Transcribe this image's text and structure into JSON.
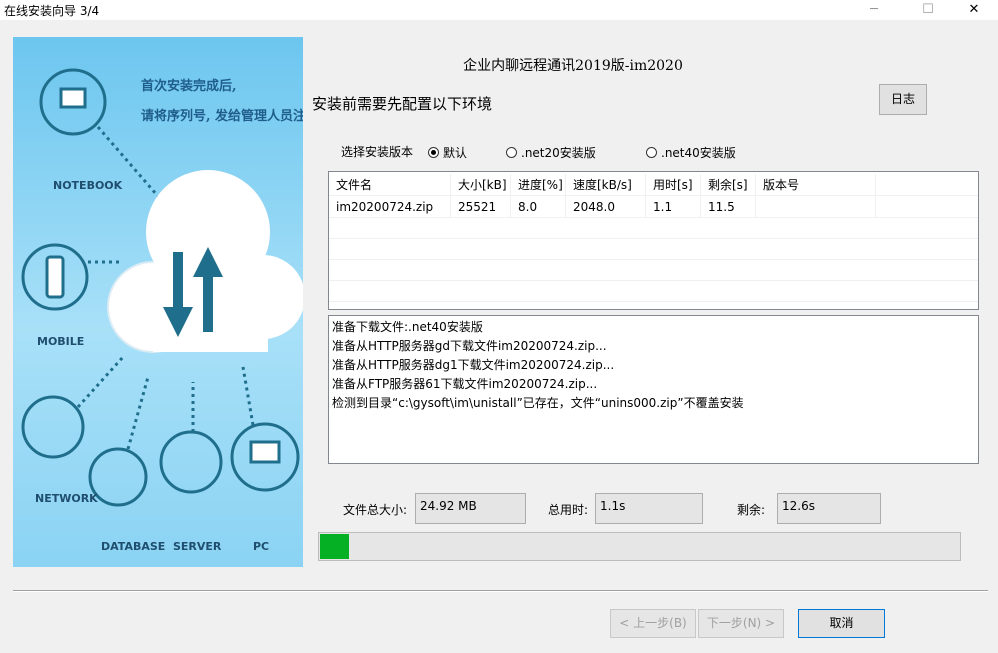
{
  "window": {
    "title": "在线安装向导 3/4"
  },
  "hero": {
    "caption_line1": "首次安装完成后,",
    "caption_line2": "请将序列号, 发给管理人员注册",
    "labels": [
      "NOTEBOOK",
      "MOBILE",
      "NETWORK",
      "DATABASE",
      "SERVER",
      "PC"
    ]
  },
  "header": {
    "product": "企业内聊远程通讯2019版-im2020",
    "subtitle": "安装前需要先配置以下环境",
    "log_button": "日志"
  },
  "version": {
    "label": "选择安装版本",
    "options": [
      {
        "label": "默认",
        "selected": true
      },
      {
        "label": ".net20安装版",
        "selected": false
      },
      {
        "label": ".net40安装版",
        "selected": false
      }
    ]
  },
  "table": {
    "columns": [
      "文件名",
      "大小[kB]",
      "进度[%]",
      "速度[kB/s]",
      "用时[s]",
      "剩余[s]",
      "版本号"
    ],
    "rows": [
      [
        "im20200724.zip",
        "25521",
        "8.0",
        "2048.0",
        "1.1",
        "11.5",
        ""
      ]
    ]
  },
  "log": {
    "lines": [
      "准备下载文件:.net40安装版",
      "准备从HTTP服务器gd下载文件im20200724.zip...",
      "准备从HTTP服务器dg1下载文件im20200724.zip...",
      "准备从FTP服务器61下载文件im20200724.zip...",
      "检测到目录“c:\\gysoft\\im\\unistall”已存在，文件“unins000.zip”不覆盖安装"
    ]
  },
  "stats": {
    "total_label": "文件总大小:",
    "total_value": "24.92 MB",
    "elapsed_label": "总用时:",
    "elapsed_value": "1.1s",
    "remaining_label": "剩余:",
    "remaining_value": "12.6s"
  },
  "progress": {
    "fraction": 0.045
  },
  "footer": {
    "back": "< 上一步(B)",
    "next": "下一步(N) >",
    "cancel": "取消"
  },
  "colors": {
    "progress": "#06b025",
    "accent": "#0078d7",
    "hero_bg": "#8bd3f3",
    "icon": "#1f6e8c"
  }
}
